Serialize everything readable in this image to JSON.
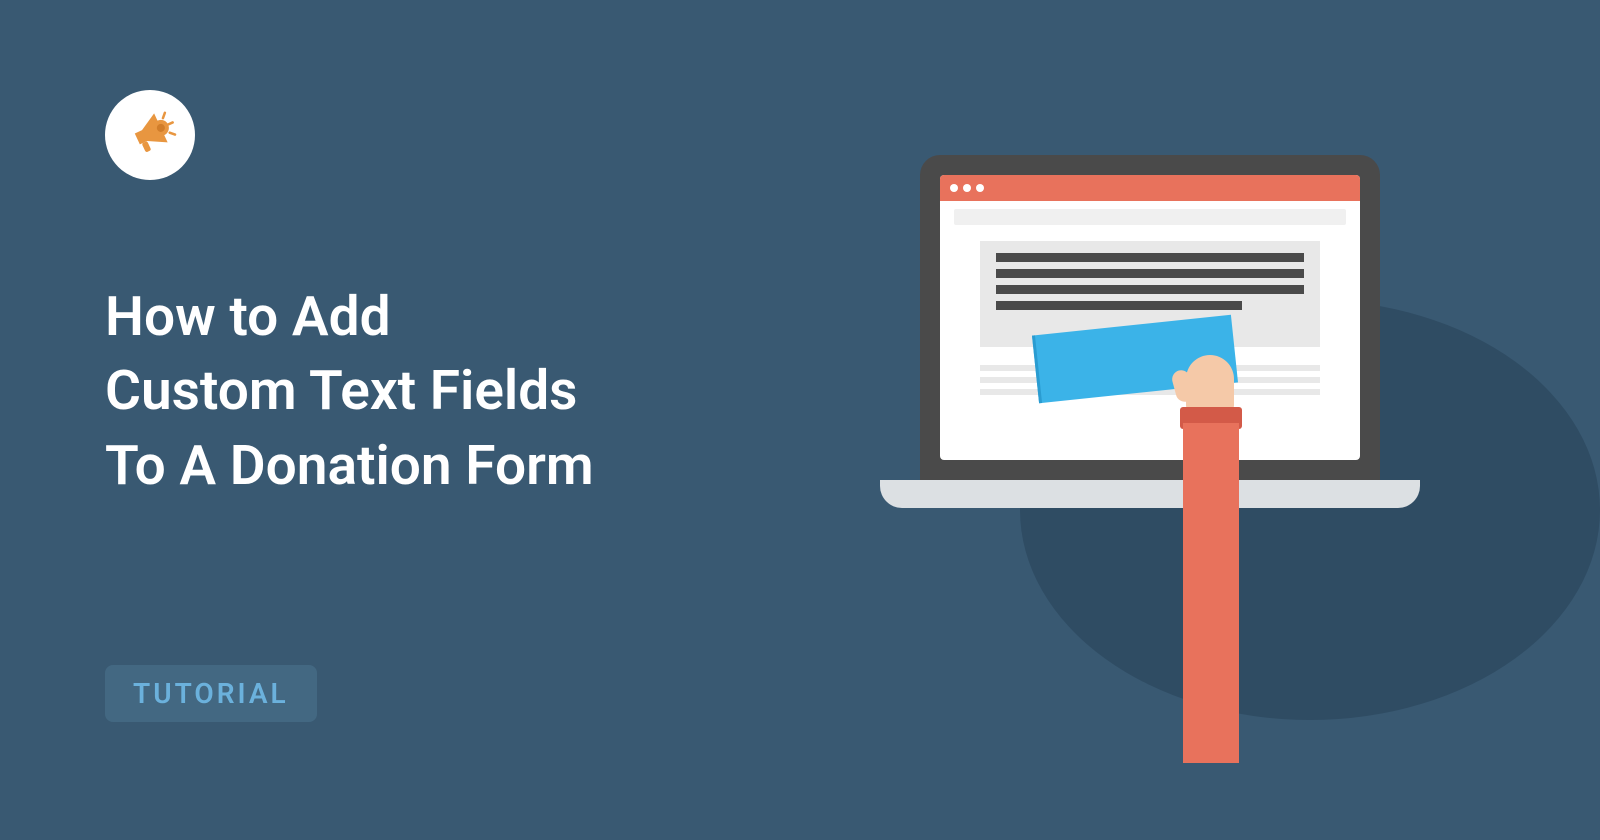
{
  "title": {
    "line1": "How to Add",
    "line2": "Custom Text Fields",
    "line3": "To A Donation Form"
  },
  "badge": {
    "label": "TUTORIAL"
  },
  "icons": {
    "logo": "megaphone-icon"
  },
  "colors": {
    "background": "#395972",
    "accent": "#e8725c",
    "highlight": "#3bb3e8",
    "badge_bg": "#436882",
    "badge_text": "#6bb1dc"
  }
}
